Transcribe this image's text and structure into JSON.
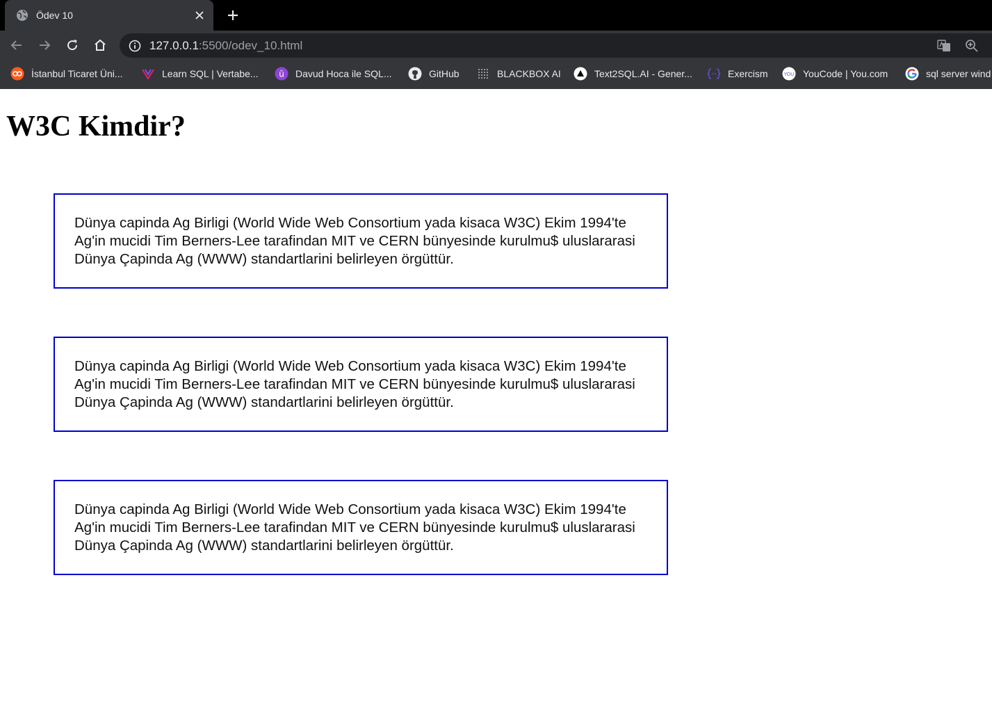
{
  "tab": {
    "title": "Ödev 10",
    "close_icon": "close-icon",
    "new_tab_icon": "plus-icon"
  },
  "address_bar": {
    "url_host": "127.0.0.1",
    "url_rest": ":5500/odev_10.html"
  },
  "bookmarks": [
    {
      "label": "İstanbul Ticaret Üni...",
      "icon": "istanbul-ticaret-logo-icon"
    },
    {
      "label": "Learn SQL | Vertabe...",
      "icon": "vertabelo-logo-icon"
    },
    {
      "label": "Davud Hoca ile SQL...",
      "icon": "davud-hoca-logo-icon"
    },
    {
      "label": "GitHub",
      "icon": "github-icon"
    },
    {
      "label": "BLACKBOX AI",
      "icon": "blackbox-ai-icon"
    },
    {
      "label": "Text2SQL.AI - Gener...",
      "icon": "text2sql-icon"
    },
    {
      "label": "Exercism",
      "icon": "exercism-icon"
    },
    {
      "label": "YouCode | You.com",
      "icon": "you-com-icon"
    },
    {
      "label": "sql server wind",
      "icon": "google-icon"
    }
  ],
  "page": {
    "heading": "W3C Kimdir?",
    "paragraphs": [
      "Dünya capinda Ag Birligi (World Wide Web Consortium yada kisaca W3C) Ekim 1994'te Ag'in mucidi Tim Berners-Lee tarafindan MIT ve CERN bünyesinde kurulmu$ uluslararasi Dünya Çapinda Ag (WWW) standartlarini belirleyen örgüttür.",
      "Dünya capinda Ag Birligi (World Wide Web Consortium yada kisaca W3C) Ekim 1994'te Ag'in mucidi Tim Berners-Lee tarafindan MIT ve CERN bünyesinde kurulmu$ uluslararasi Dünya Çapinda Ag (WWW) standartlarini belirleyen örgüttür.",
      "Dünya capinda Ag Birligi (World Wide Web Consortium yada kisaca W3C) Ekim 1994'te Ag'in mucidi Tim Berners-Lee tarafindan MIT ve CERN bünyesinde kurulmu$ uluslararasi Dünya Çapinda Ag (WWW) standartlarini belirleyen örgüttür."
    ]
  },
  "colors": {
    "box_border": "#0000cc",
    "chrome_dark": "#35363a",
    "tabstrip": "#000000",
    "omnibox": "#202124"
  }
}
